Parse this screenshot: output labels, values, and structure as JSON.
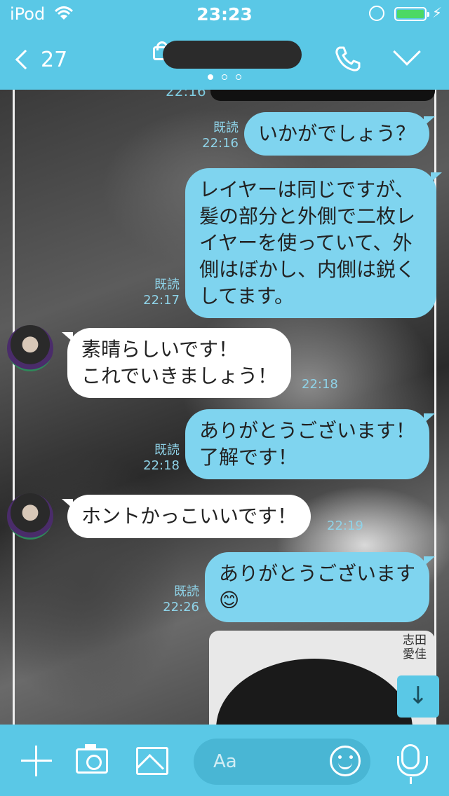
{
  "status_bar": {
    "carrier": "iPod",
    "time": "23:23",
    "charging_icon": "⚡"
  },
  "header": {
    "back_count": "27",
    "page_dots": 3
  },
  "messages": [
    {
      "sender": "me",
      "text": "いかがでしょう？",
      "read": "既読",
      "time": "22:16"
    },
    {
      "sender": "me",
      "text": "レイヤーは同じですが、\n髪の部分と外側で二枚レ\nイヤーを使っていて、外\n側はぼかし、内側は鋭く\nしてます。",
      "read": "既読",
      "time": "22:17"
    },
    {
      "sender": "them",
      "text": "素晴らしいです！\nこれでいきましょう！",
      "time": "22:18"
    },
    {
      "sender": "me",
      "text": "ありがとうございます！\n了解です！",
      "read": "既読",
      "time": "22:18"
    },
    {
      "sender": "them",
      "text": "ホントかっこいいです！",
      "time": "22:19"
    },
    {
      "sender": "me",
      "text": "ありがとうございます\n😊",
      "read": "既読",
      "time": "22:26"
    }
  ],
  "cut_off_time": "22:16",
  "photo_caption": "志田\n愛佳",
  "scroll_down_glyph": "↓",
  "composer": {
    "placeholder": "Aa"
  }
}
